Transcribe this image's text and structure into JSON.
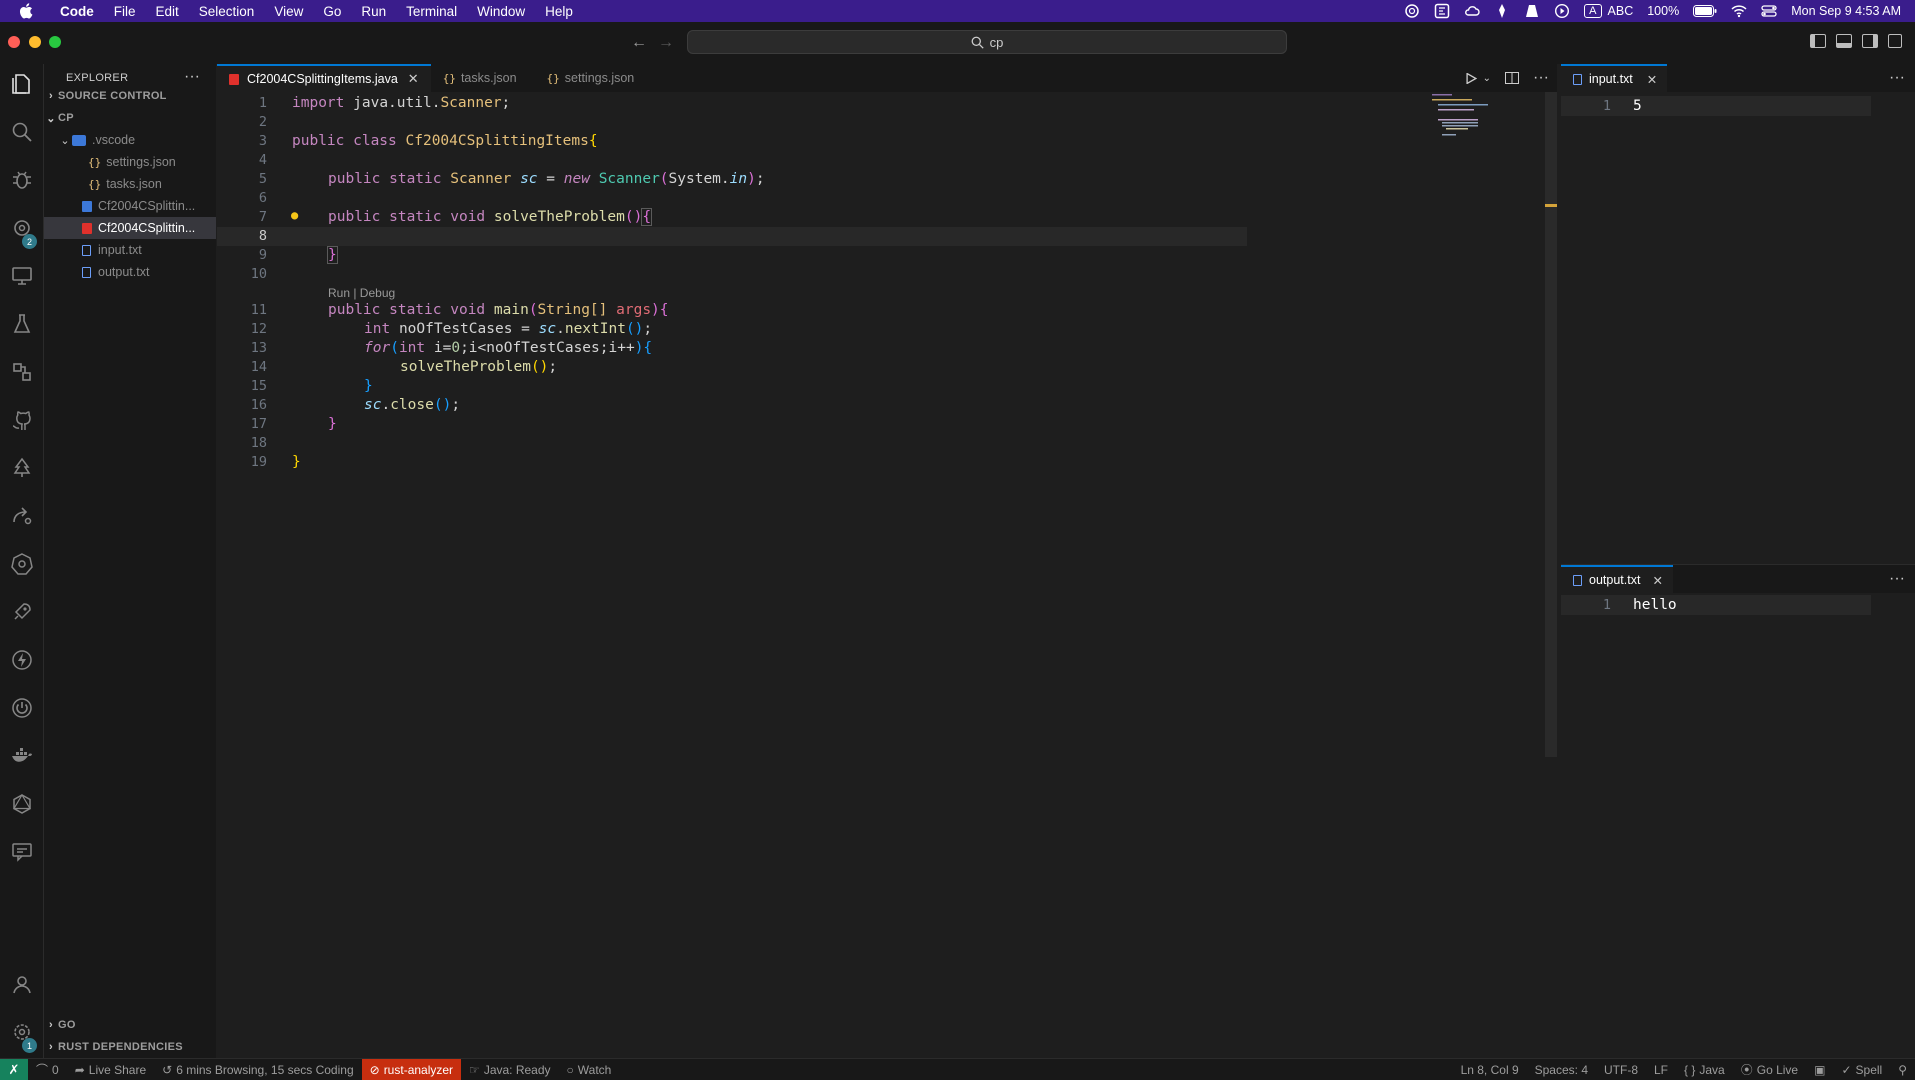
{
  "menubar": {
    "app": "Code",
    "items": [
      "File",
      "Edit",
      "Selection",
      "View",
      "Go",
      "Run",
      "Terminal",
      "Window",
      "Help"
    ],
    "input_source": "ABC",
    "input_badge": "A",
    "battery": "100%",
    "datetime": "Mon Sep 9  4:53 AM"
  },
  "titlebar": {
    "search": "cp"
  },
  "sidebar": {
    "title": "EXPLORER",
    "source_control": "SOURCE CONTROL",
    "workspace": "CP",
    "tree": {
      "vscode_folder": ".vscode",
      "settings": "settings.json",
      "tasks": "tasks.json",
      "java1": "Cf2004CSplittin...",
      "java2": "Cf2004CSplittin...",
      "input": "input.txt",
      "output": "output.txt"
    },
    "go_section": "GO",
    "rust_section": "RUST DEPENDENCIES"
  },
  "activity": {
    "extensions_badge": "2",
    "settings_badge": "1"
  },
  "tabs": {
    "active": "Cf2004CSplittingItems.java",
    "tasks": "tasks.json",
    "settings": "settings.json"
  },
  "editor": {
    "line_numbers": [
      "1",
      "2",
      "3",
      "4",
      "5",
      "6",
      "7",
      "8",
      "9",
      "10",
      "11",
      "12",
      "13",
      "14",
      "15",
      "16",
      "17",
      "18",
      "19"
    ],
    "codelens": "Run | Debug",
    "code": {
      "l1_kw": "import",
      "l1_pkg": "java.util.",
      "l1_cls": "Scanner",
      "l1_end": ";",
      "l3_kw": "public class",
      "l3_cls": "Cf2004CSplittingItems",
      "l3_br": "{",
      "l5_kw": "public static",
      "l5_ty": "Scanner",
      "l5_var": "sc",
      "l5_eq": "=",
      "l5_new": "new",
      "l5_ctor": "Scanner",
      "l5_p1": "(",
      "l5_arg": "System.",
      "l5_in": "in",
      "l5_p2": ")",
      "l5_end": ";",
      "l7_kw": "public static",
      "l7_void": "void",
      "l7_fn": "solveTheProblem",
      "l7_par": "()",
      "l7_br": "{",
      "l9_br": "}",
      "l11_kw": "public static",
      "l11_void": "void",
      "l11_fn": "main",
      "l11_p1": "(",
      "l11_ty": "String[]",
      "l11_arg": "args",
      "l11_p2": ")",
      "l11_br": "{",
      "l12_ty": "int",
      "l12_var": "noOfTestCases",
      "l12_eq": "=",
      "l12_sc": "sc",
      "l12_dot": ".",
      "l12_fn": "nextInt",
      "l12_par": "()",
      "l12_end": ";",
      "l13_for": "for",
      "l13_p1": "(",
      "l13_int": "int",
      "l13_a": " i=",
      "l13_zero": "0",
      "l13_b": ";i<noOfTestCases;i++",
      "l13_p2": ")",
      "l13_br": "{",
      "l14_fn": "solveTheProblem",
      "l14_par": "()",
      "l14_end": ";",
      "l15_br": "}",
      "l16_sc": "sc",
      "l16_dot": ".",
      "l16_fn": "close",
      "l16_par": "()",
      "l16_end": ";",
      "l17_br": "}",
      "l19_br": "}"
    }
  },
  "input_pane": {
    "tab": "input.txt",
    "line": "1",
    "content": "5"
  },
  "output_pane": {
    "tab": "output.txt",
    "line": "1",
    "content": "hello"
  },
  "statusbar": {
    "ports": "0",
    "live_share": "Live Share",
    "time": "6 mins Browsing, 15 secs Coding",
    "rust": "rust-analyzer",
    "java": "Java: Ready",
    "watch": "Watch",
    "position": "Ln 8, Col 9",
    "spaces": "Spaces: 4",
    "encoding": "UTF-8",
    "eol": "LF",
    "language": "Java",
    "golive": "Go Live",
    "spell": "Spell"
  }
}
